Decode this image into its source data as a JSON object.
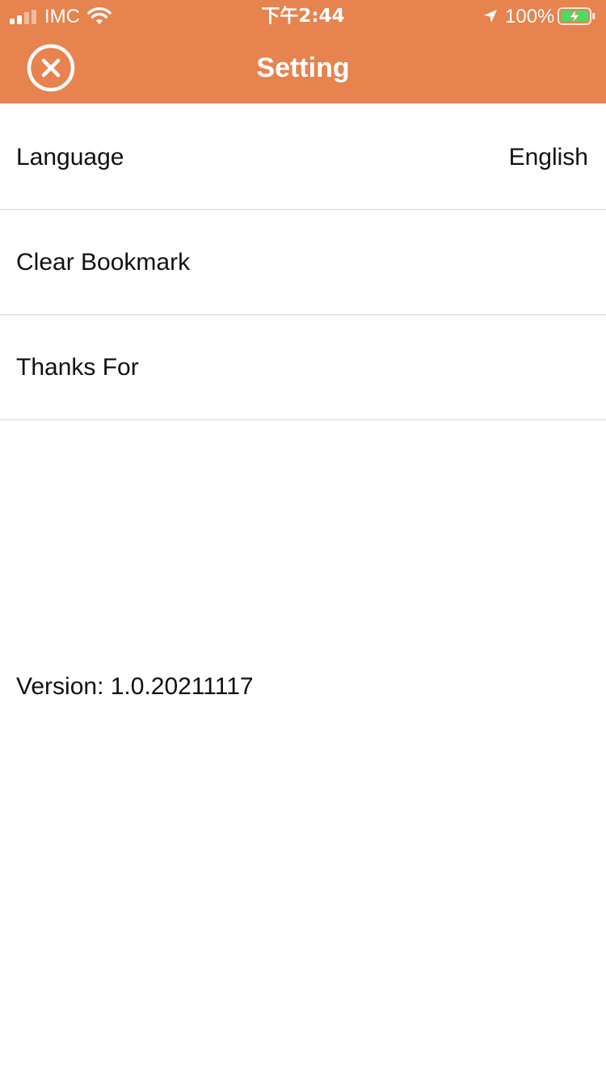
{
  "colors": {
    "header_bg": "#E6834F",
    "header_text": "#FFFFFF",
    "battery_fill": "#4CD964",
    "divider": "#D6D6D6"
  },
  "status_bar": {
    "carrier": "IMC",
    "time": "下午2:44",
    "battery_percent": "100%",
    "icons": [
      "signal-icon",
      "wifi-icon",
      "location-arrow-icon",
      "battery-charging-icon"
    ]
  },
  "nav": {
    "title": "Setting",
    "close_icon": "close-circle-icon"
  },
  "settings": {
    "language_label": "Language",
    "language_value": "English",
    "clear_bookmark_label": "Clear Bookmark",
    "thanks_for_label": "Thanks For"
  },
  "version_text": "Version: 1.0.20211117"
}
